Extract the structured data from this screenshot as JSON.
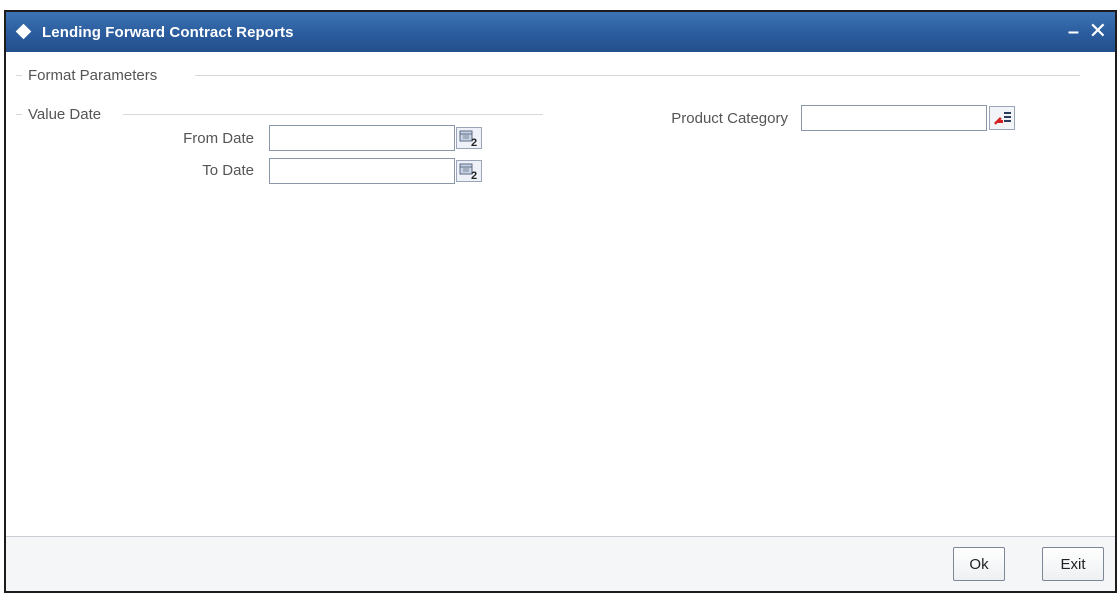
{
  "window": {
    "title": "Lending Forward Contract Reports",
    "minimize_glyph": "–",
    "close_glyph": "✕"
  },
  "sections": {
    "format_parameters": "Format Parameters",
    "value_date": "Value Date"
  },
  "fields": {
    "from_date": {
      "label": "From Date",
      "value": ""
    },
    "to_date": {
      "label": "To Date",
      "value": ""
    },
    "product_category": {
      "label": "Product Category",
      "value": ""
    }
  },
  "icons": {
    "calendar": "calendar-icon",
    "lov": "list-of-values-icon"
  },
  "buttons": {
    "ok": "Ok",
    "exit": "Exit"
  },
  "colors": {
    "titlebar": "#2b5c9e",
    "label_text": "#555555",
    "input_border": "#8a97a8"
  }
}
